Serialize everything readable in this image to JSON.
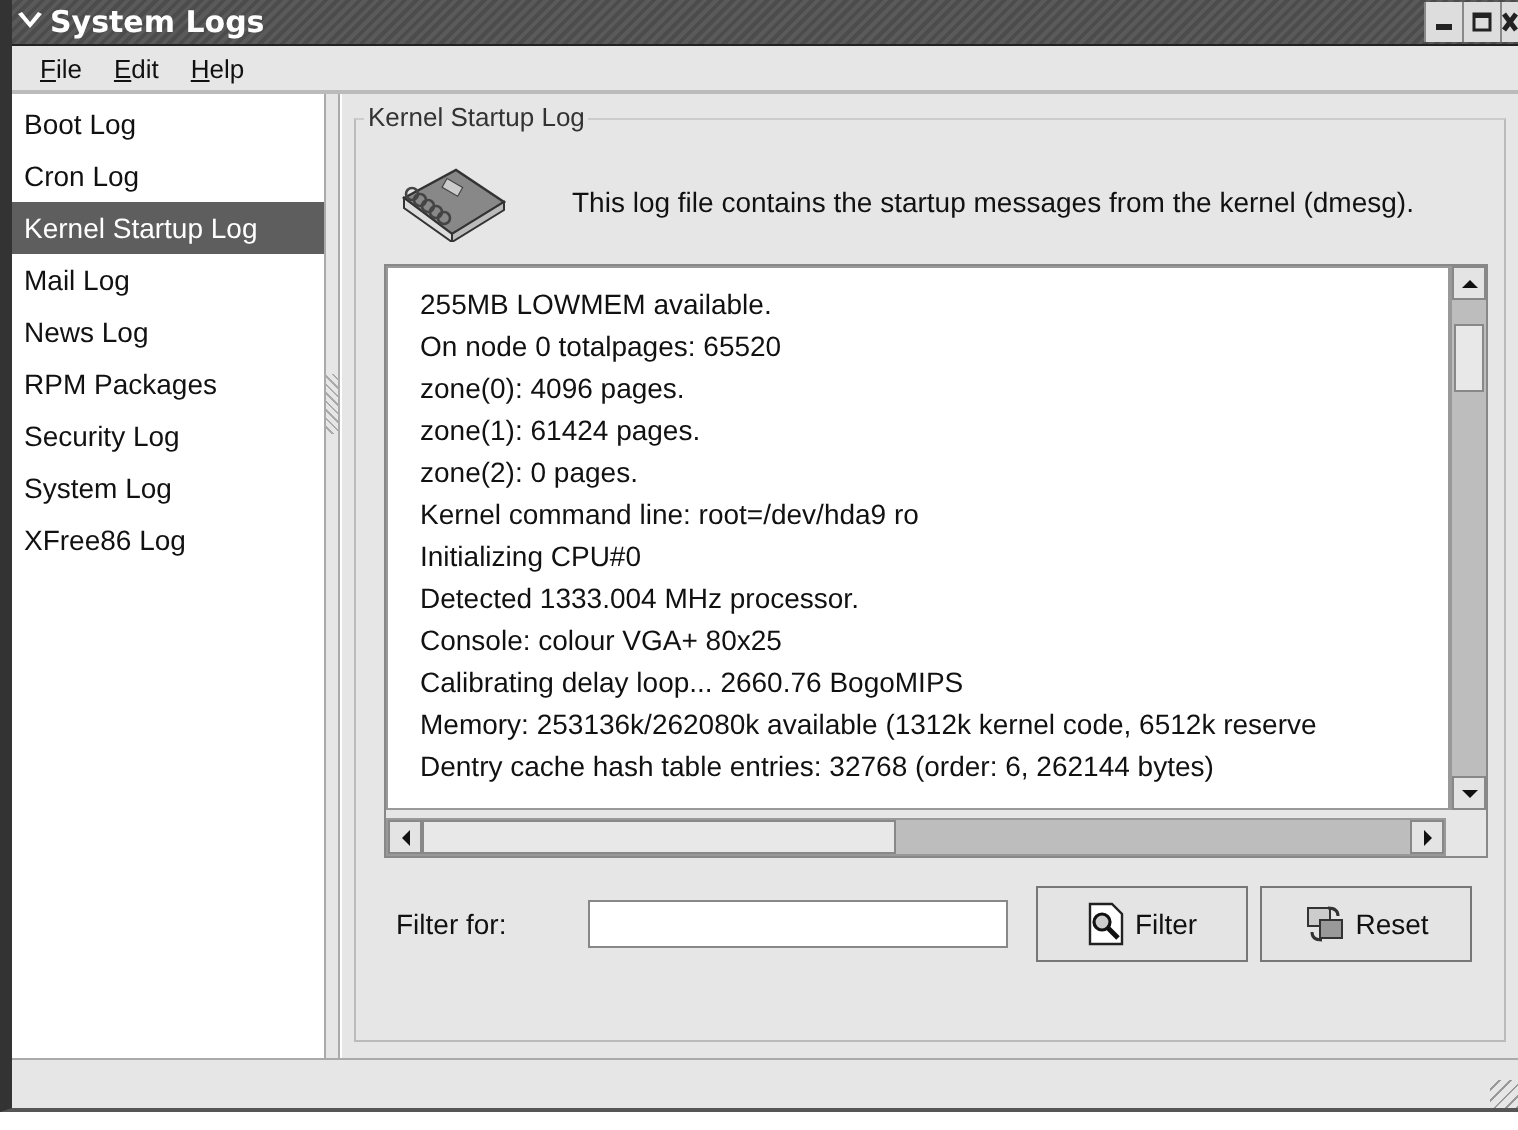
{
  "window": {
    "title": "System Logs"
  },
  "menu": [
    {
      "label": "File"
    },
    {
      "label": "Edit"
    },
    {
      "label": "Help"
    }
  ],
  "sidebar": {
    "items": [
      {
        "label": "Boot Log",
        "selected": false
      },
      {
        "label": "Cron Log",
        "selected": false
      },
      {
        "label": "Kernel Startup Log",
        "selected": true
      },
      {
        "label": "Mail Log",
        "selected": false
      },
      {
        "label": "News Log",
        "selected": false
      },
      {
        "label": "RPM Packages",
        "selected": false
      },
      {
        "label": "Security Log",
        "selected": false
      },
      {
        "label": "System Log",
        "selected": false
      },
      {
        "label": "XFree86 Log",
        "selected": false
      }
    ]
  },
  "panel": {
    "title": "Kernel Startup Log",
    "description": "This log file contains the startup messages from the kernel (dmesg)."
  },
  "log_lines": [
    "255MB LOWMEM available.",
    "On node 0 totalpages: 65520",
    "zone(0): 4096 pages.",
    "zone(1): 61424 pages.",
    "zone(2): 0 pages.",
    "Kernel command line: root=/dev/hda9 ro",
    "Initializing CPU#0",
    "Detected 1333.004 MHz processor.",
    "Console: colour VGA+ 80x25",
    "Calibrating delay loop... 2660.76 BogoMIPS",
    "Memory: 253136k/262080k available (1312k kernel code, 6512k reserve",
    "Dentry cache hash table entries: 32768 (order: 6, 262144 bytes)"
  ],
  "filter": {
    "label": "Filter for:"
  },
  "buttons": [
    {
      "label": "Filter",
      "kind": "filter"
    },
    {
      "label": "Reset",
      "kind": "reset"
    }
  ]
}
